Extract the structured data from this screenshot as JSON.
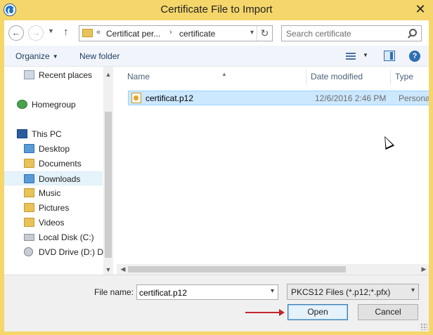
{
  "window": {
    "title": "Certificate File to Import",
    "close_label": "✕"
  },
  "address": {
    "prefix": "«",
    "segments": [
      "Certificat per...",
      "certificate"
    ],
    "separator": "›"
  },
  "search": {
    "placeholder": "Search certificate"
  },
  "toolbar": {
    "organize_label": "Organize",
    "new_folder_label": "New folder",
    "help_label": "?"
  },
  "nav": {
    "items": [
      {
        "label": "Recent places",
        "icon": "recent-places-icon"
      },
      {
        "label": "Homegroup",
        "icon": "homegroup-icon"
      },
      {
        "label": "This PC",
        "icon": "computer-icon"
      },
      {
        "label": "Desktop",
        "icon": "folder-icon"
      },
      {
        "label": "Documents",
        "icon": "folder-icon"
      },
      {
        "label": "Downloads",
        "icon": "downloads-folder-icon",
        "selected": true
      },
      {
        "label": "Music",
        "icon": "music-folder-icon"
      },
      {
        "label": "Pictures",
        "icon": "folder-icon"
      },
      {
        "label": "Videos",
        "icon": "folder-icon"
      },
      {
        "label": "Local Disk (C:)",
        "icon": "hard-drive-icon"
      },
      {
        "label": "DVD Drive (D:) Di",
        "icon": "dvd-drive-icon"
      }
    ]
  },
  "file_list": {
    "columns": [
      "Name",
      "Date modified",
      "Type"
    ],
    "rows": [
      {
        "name": "certificat.p12",
        "date_modified": "12/6/2016 2:46 PM",
        "type": "Personal I",
        "selected": true
      }
    ]
  },
  "footer": {
    "file_name_label": "File name:",
    "file_name_value": "certificat.p12",
    "file_type_filter": "PKCS12 Files (*.p12;*.pfx)",
    "open_label": "Open",
    "cancel_label": "Cancel"
  },
  "colors": {
    "window_frame": "#f5d66b",
    "selection": "#cce8ff",
    "annotation_arrow": "#c0262c"
  }
}
